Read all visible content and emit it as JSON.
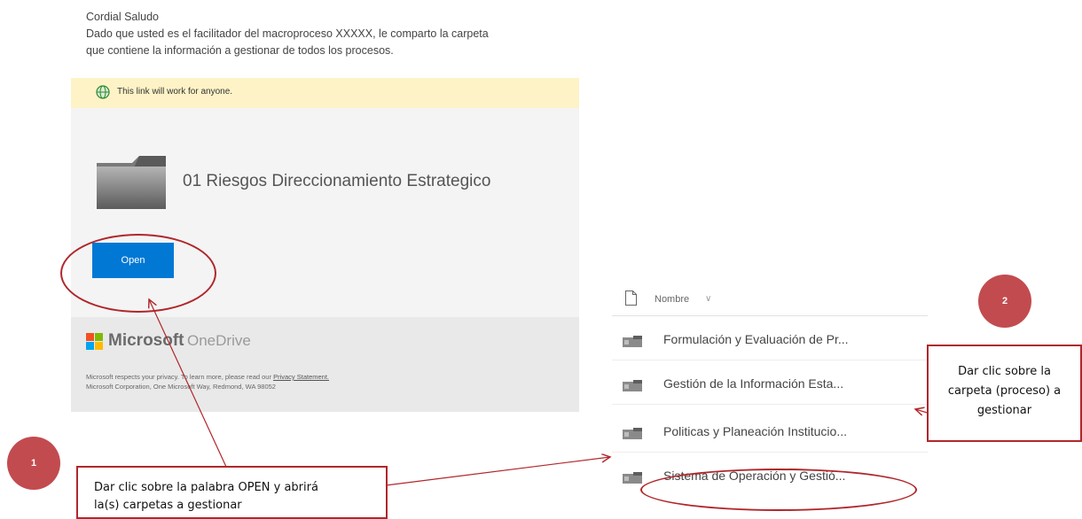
{
  "email": {
    "greeting": "Cordial Saludo",
    "line1": "Dado que usted es el facilitador del macroproceso XXXXX, le comparto la carpeta",
    "line2": "que contiene la información a gestionar de todos los procesos."
  },
  "share_card": {
    "banner_text": "This link will work for anyone.",
    "folder_name": "01 Riesgos Direccionamiento Estrategico",
    "open_label": "Open",
    "brand_microsoft": "Microsoft",
    "brand_onedrive": "OneDrive",
    "privacy_text_before": "Microsoft respects your privacy. To learn more, please read our ",
    "privacy_link": "Privacy Statement.",
    "address": "Microsoft Corporation, One Microsoft Way, Redmond, WA 98052"
  },
  "file_list": {
    "header": "Nombre",
    "rows": [
      "Formulación y Evaluación de Pr...",
      "Gestión de la Información Esta...",
      "Politicas y Planeación Institucio...",
      "Sistema de Operación y Gestió..."
    ]
  },
  "annotations": {
    "badge1": "1",
    "badge2": "2",
    "callout1_line1": "Dar clic sobre la palabra OPEN y abrirá",
    "callout1_line2": "la(s) carpetas a gestionar",
    "callout2_line1": "Dar clic sobre la",
    "callout2_line2": "carpeta (proceso) a",
    "callout2_line3": "gestionar"
  },
  "colors": {
    "open_button": "#0078d4",
    "annotation_red": "#b0272b",
    "badge_fill": "#c24b4f",
    "banner_yellow": "#fdf3c6"
  }
}
